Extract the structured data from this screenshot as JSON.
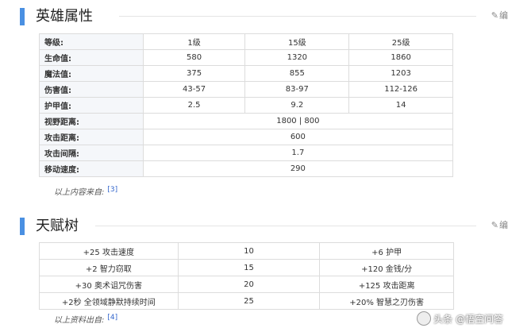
{
  "section1": {
    "title": "英雄属性",
    "edit": "编"
  },
  "attr_headers": [
    "等级:",
    "1级",
    "15级",
    "25级"
  ],
  "attr_rows3": [
    [
      "生命值:",
      "580",
      "1320",
      "1860"
    ],
    [
      "魔法值:",
      "375",
      "855",
      "1203"
    ],
    [
      "伤害值:",
      "43-57",
      "83-97",
      "112-126"
    ],
    [
      "护甲值:",
      "2.5",
      "9.2",
      "14"
    ]
  ],
  "attr_rows1": [
    [
      "视野距离:",
      "1800 | 800"
    ],
    [
      "攻击距离:",
      "600"
    ],
    [
      "攻击间隔:",
      "1.7"
    ],
    [
      "移动速度:",
      "290"
    ]
  ],
  "note1": {
    "text": "以上内容来自:",
    "ref": "[3]"
  },
  "section2": {
    "title": "天赋树",
    "edit": "编"
  },
  "talents": [
    [
      "+25 攻击速度",
      "10",
      "+6 护甲"
    ],
    [
      "+2 智力窃取",
      "15",
      "+120 金钱/分"
    ],
    [
      "+30 奥术诅咒伤害",
      "20",
      "+125 攻击距离"
    ],
    [
      "+2秒 全领域静默持续时间",
      "25",
      "+20% 智慧之刃伤害"
    ]
  ],
  "note2": {
    "text": "以上资料出自:",
    "ref": "[4]"
  },
  "watermark": {
    "text": "头条 @悟空问答"
  }
}
